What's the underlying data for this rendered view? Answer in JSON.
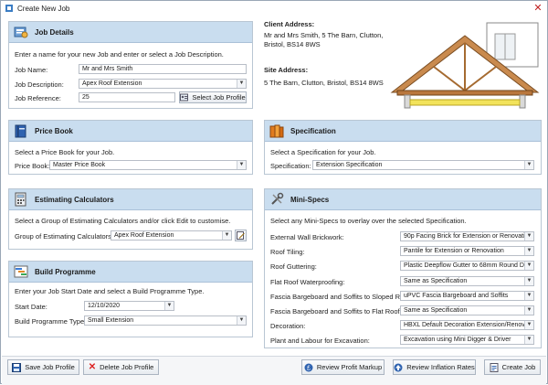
{
  "window": {
    "title": "Create New Job",
    "close_glyph": "✕"
  },
  "job_details": {
    "header": "Job Details",
    "description": "Enter a name for your new Job and enter or select a Job Description.",
    "name_label": "Job Name:",
    "name_value": "Mr and Mrs Smith",
    "desc_label": "Job Description:",
    "desc_value": "Apex Roof Extension",
    "ref_label": "Job Reference:",
    "ref_value": "25",
    "select_profile_button": "Select Job Profile"
  },
  "client": {
    "client_label": "Client Address:",
    "client_line1": "Mr and Mrs Smith, 5 The Barn, Clutton,",
    "client_line2": "Bristol, BS14 8WS",
    "site_label": "Site Address:",
    "site_line1": "5 The Barn, Clutton, Bristol, BS14 8WS"
  },
  "price_book": {
    "header": "Price Book",
    "description": "Select a Price Book for your Job.",
    "label": "Price Book:",
    "value": "Master Price Book"
  },
  "specification": {
    "header": "Specification",
    "description": "Select a Specification for your Job.",
    "label": "Specification:",
    "value": "Extension Specification"
  },
  "estimating": {
    "header": "Estimating Calculators",
    "description": "Select a Group of Estimating Calculators and/or click Edit to customise.",
    "label": "Group of Estimating Calculators:",
    "value": "Apex Roof Extension"
  },
  "build_programme": {
    "header": "Build Programme",
    "description": "Enter your Job Start Date and select a Build Programme Type.",
    "start_label": "Start Date:",
    "start_value": "12/10/2020",
    "type_label": "Build Programme Type:",
    "type_value": "Small Extension"
  },
  "mini_specs": {
    "header": "Mini-Specs",
    "description": "Select any Mini-Specs to overlay over the selected Specification.",
    "rows": [
      {
        "label": "External Wall Brickwork:",
        "value": "90p Facing Brick for Extension or Renovati"
      },
      {
        "label": "Roof Tiling:",
        "value": "Pantile for Extension or Renovation"
      },
      {
        "label": "Roof Guttering:",
        "value": "Plastic Deepflow Gutter to 68mm Round D"
      },
      {
        "label": "Flat Roof Waterproofing:",
        "value": "Same as Specification"
      },
      {
        "label": "Fascia Bargeboard and Soffits to Sloped Roofs:",
        "value": "uPVC Fascia Bargeboard and Soffits"
      },
      {
        "label": "Fascia Bargeboard and Soffits to Flat Roofs:",
        "value": "Same as Specification"
      },
      {
        "label": "Decoration:",
        "value": "HBXL Default Decoration Extension/Renov"
      },
      {
        "label": "Plant and Labour for Excavation:",
        "value": "Excavation using Mini Digger & Driver"
      }
    ]
  },
  "footer": {
    "save_profile": "Save Job Profile",
    "delete_profile": "Delete Job Profile",
    "review_markup": "Review Profit Markup",
    "review_inflation": "Review Inflation Rates",
    "create_job": "Create Job"
  }
}
